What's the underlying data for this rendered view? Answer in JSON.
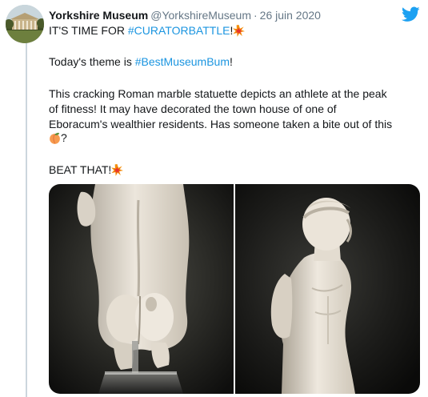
{
  "tweet": {
    "author_name": "Yorkshire Museum",
    "handle": "@YorkshireMuseum",
    "separator": "·",
    "date": "26 juin 2020",
    "line1_prefix": "IT'S TIME FOR ",
    "line1_hashtag": "#CURATORBATTLE",
    "line1_suffix": "!",
    "line2_prefix": "Today's theme is ",
    "line2_hashtag": "#BestMuseumBum",
    "line2_suffix": "!",
    "body_line1": "This cracking Roman marble statuette depicts an athlete at the peak",
    "body_line2": "of fitness! It may have decorated the town house of one of",
    "body_line3": "Eboracum's wealthier residents. Has someone taken a bite out of this",
    "body_line4_suffix": "?",
    "closing_prefix": "BEAT THAT!"
  },
  "icons": {
    "collision_emoji": "collision-icon",
    "peach_emoji": "peach-icon",
    "logo": "twitter-bird-icon"
  },
  "colors": {
    "hashtag": "#1b95e0",
    "twitter_blue": "#1da1f2",
    "muted": "#657786",
    "text": "#14171a"
  }
}
